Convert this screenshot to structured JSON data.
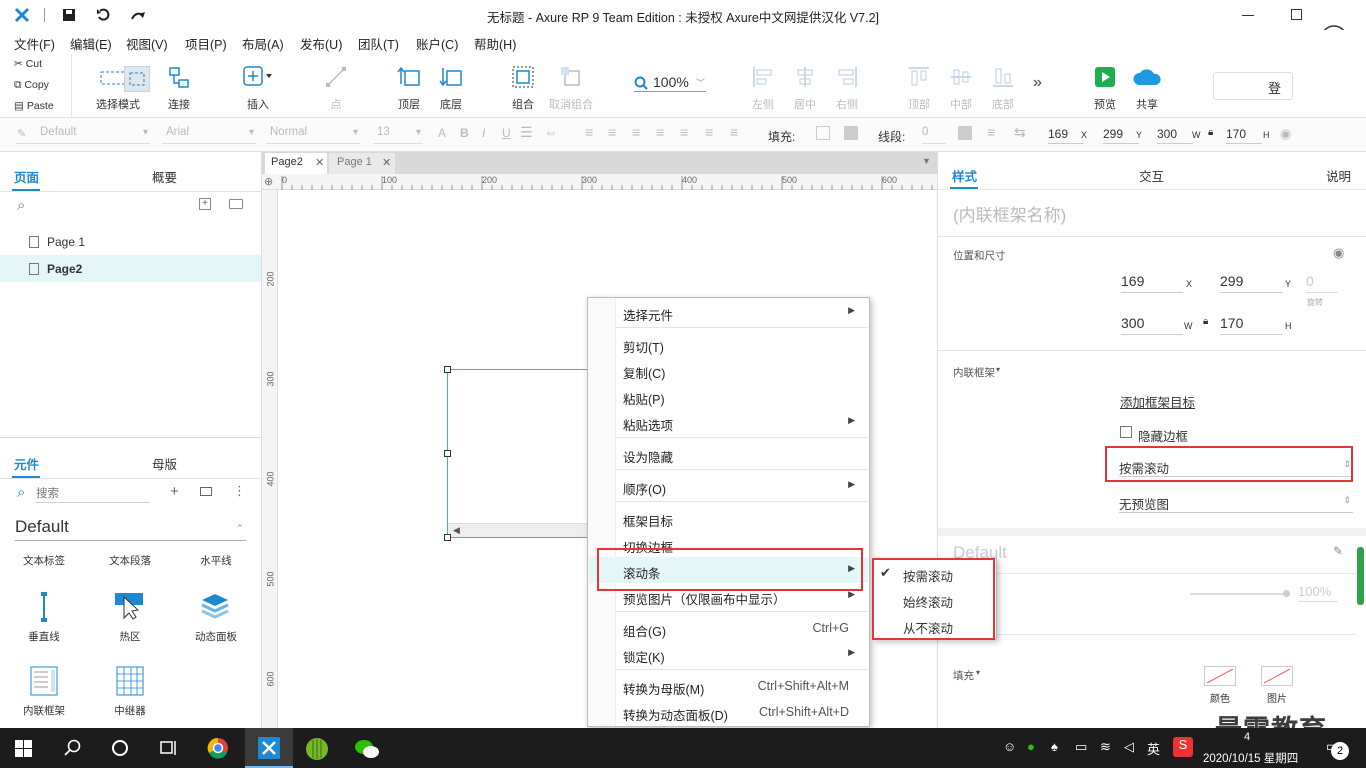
{
  "window": {
    "title": "无标题 - Axure RP 9 Team Edition : 未授权    Axure中文网提供汉化 V7.2]"
  },
  "menu": [
    "文件(F)",
    "编辑(E)",
    "视图(V)",
    "项目(P)",
    "布局(A)",
    "发布(U)",
    "团队(T)",
    "账户(C)",
    "帮助(H)"
  ],
  "clipboard": {
    "cut": "Cut",
    "copy": "Copy",
    "paste": "Paste"
  },
  "toolbar": {
    "select_mode": "选择模式",
    "connect": "连接",
    "insert": "插入",
    "point": "点",
    "top": "顶层",
    "bottom": "底层",
    "group": "组合",
    "ungroup": "取消组合",
    "zoom": "100%",
    "left": "左侧",
    "center": "居中",
    "right": "右侧",
    "top_align": "顶部",
    "middle": "中部",
    "bottom_align": "底部",
    "preview": "预览",
    "share": "共享",
    "login": "登"
  },
  "format": {
    "style": "Default",
    "font": "Arial",
    "weight": "Normal",
    "size": "13",
    "fill_label": "填充:",
    "line_label": "线段:",
    "line_value": "0",
    "x": "169",
    "x_label": "X",
    "y": "299",
    "y_label": "Y",
    "w": "300",
    "w_label": "W",
    "h": "170",
    "h_label": "H"
  },
  "left_panel": {
    "tab_pages": "页面",
    "tab_outline": "概要",
    "pages": [
      "Page 1",
      "Page2"
    ],
    "tab_widgets": "元件",
    "tab_masters": "母版",
    "search_placeholder": "搜索",
    "library": "Default",
    "widgets_row1": [
      "文本标签",
      "文本段落",
      "水平线"
    ],
    "widgets_row2": [
      "垂直线",
      "热区",
      "动态面板"
    ],
    "widgets_row3": [
      "内联框架",
      "中继器"
    ]
  },
  "doc_tabs": [
    "Page2",
    "Page 1"
  ],
  "ruler_h": [
    "0",
    "100",
    "200",
    "300",
    "400",
    "500",
    "600"
  ],
  "ruler_v": [
    "200",
    "300",
    "400",
    "500",
    "600"
  ],
  "context_menu": {
    "items": [
      {
        "label": "选择元件",
        "arrow": true
      },
      {
        "label": "剪切(T)"
      },
      {
        "label": "复制(C)"
      },
      {
        "label": "粘贴(P)"
      },
      {
        "label": "粘贴选项",
        "arrow": true
      },
      {
        "label": "设为隐藏"
      },
      {
        "label": "顺序(O)",
        "arrow": true
      },
      {
        "label": "框架目标"
      },
      {
        "label": "切换边框"
      },
      {
        "label": "滚动条",
        "arrow": true
      },
      {
        "label": "预览图片（仅限画布中显示）",
        "arrow": true
      },
      {
        "label": "组合(G)",
        "shortcut": "Ctrl+G"
      },
      {
        "label": "锁定(K)",
        "arrow": true
      },
      {
        "label": "转换为母版(M)",
        "shortcut": "Ctrl+Shift+Alt+M"
      },
      {
        "label": "转换为动态面板(D)",
        "shortcut": "Ctrl+Shift+Alt+D"
      }
    ]
  },
  "submenu": {
    "items": [
      "按需滚动",
      "始终滚动",
      "从不滚动"
    ],
    "checked": "按需滚动"
  },
  "right_panel": {
    "tab_style": "样式",
    "tab_interact": "交互",
    "tab_notes": "说明",
    "name_placeholder": "(内联框架名称)",
    "pos_size": "位置和尺寸",
    "x": "169",
    "y": "299",
    "rot": "0",
    "rot_label": "旋转",
    "w": "300",
    "h": "170",
    "iframe": "内联框架",
    "add_target": "添加框架目标",
    "hide_border": "隐藏边框",
    "scroll": "按需滚动",
    "preview": "无预览图",
    "style_name": "Default",
    "opacity": "100%",
    "fill": "填充",
    "color": "颜色",
    "image": "图片"
  },
  "watermark": "最需教育",
  "taskbar": {
    "time": "4",
    "date": "2020/10/15 星期四",
    "ime": "英",
    "notify": "2"
  }
}
